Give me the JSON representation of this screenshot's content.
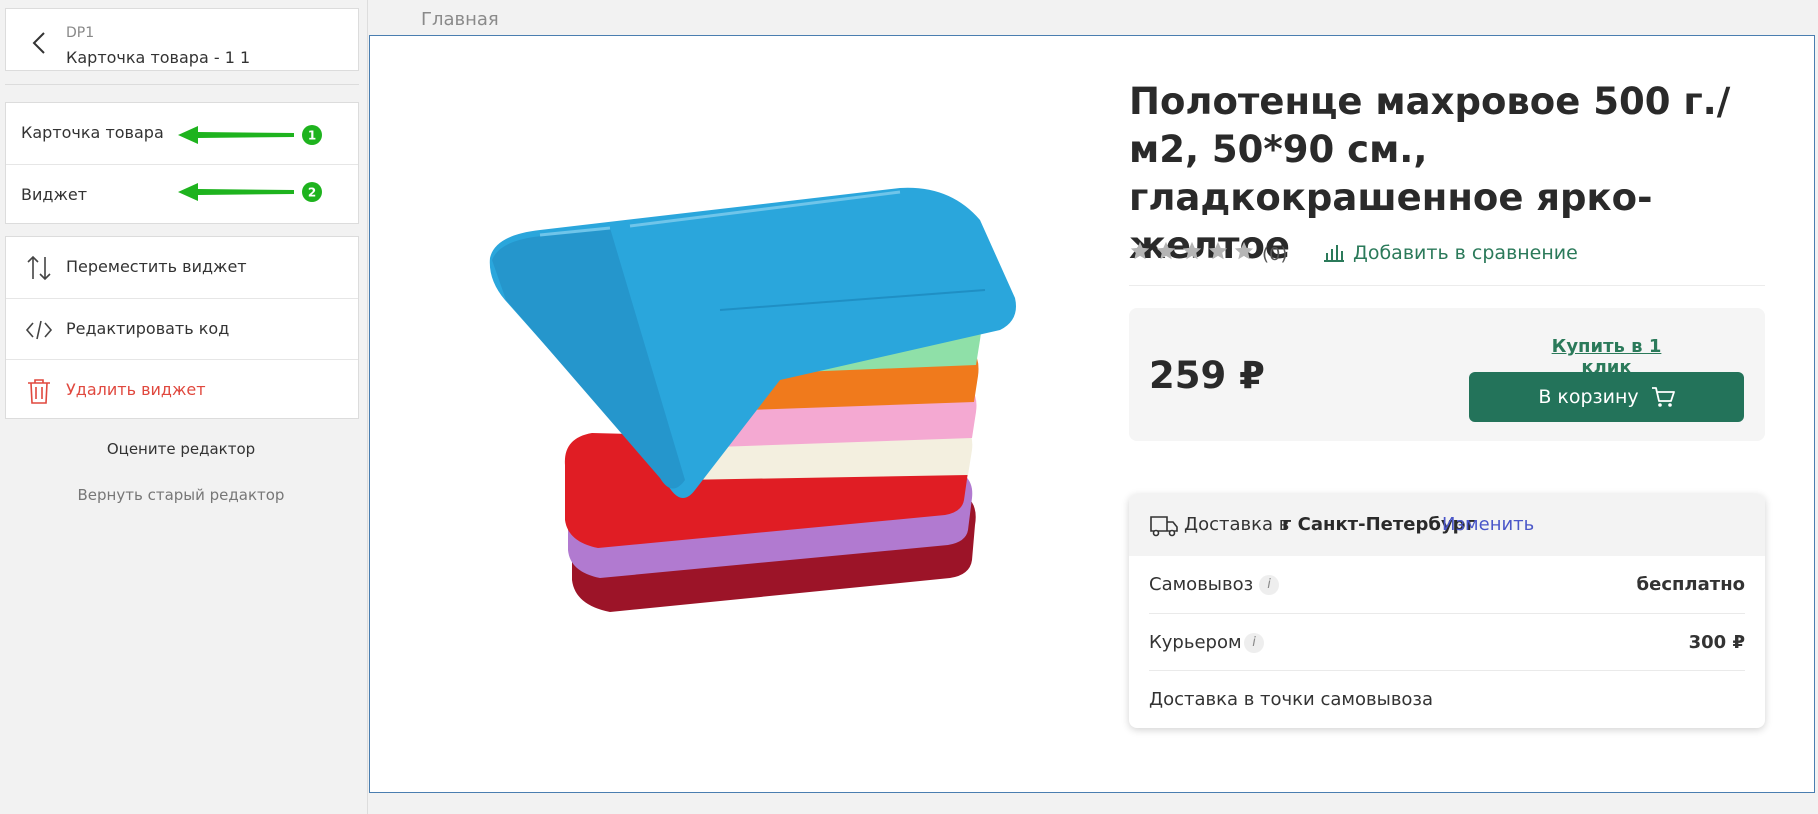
{
  "sidebar": {
    "header": {
      "subtitle": "DP1",
      "title": "Карточка товара - 1 1"
    },
    "nav": [
      {
        "label": "Карточка товара",
        "marker": "1"
      },
      {
        "label": "Виджет",
        "marker": "2"
      }
    ],
    "actions": [
      {
        "label": "Переместить виджет",
        "icon": "sort-arrows-icon"
      },
      {
        "label": "Редактировать код",
        "icon": "code-icon"
      },
      {
        "label": "Удалить виджет",
        "icon": "trash-icon"
      }
    ],
    "rate_label": "Оцените редактор",
    "revert_label": "Вернуть старый редактор"
  },
  "breadcrumb": "Главная",
  "product": {
    "title": "Полотенце махровое 500 г./м2, 50*90 см., гладкокрашенное ярко-желтое",
    "rating_count": "(0)",
    "compare_label": "Добавить в сравнение",
    "price": "259 ₽",
    "one_click_label": "Купить в 1 клик",
    "cart_label": "В корзину"
  },
  "delivery": {
    "prefix": "Доставка в",
    "city": "г Санкт-Петербург",
    "change_label": "Изменить",
    "rows": [
      {
        "name": "Самовывоз",
        "value": "бесплатно"
      },
      {
        "name": "Курьером",
        "value": "300 ₽"
      },
      {
        "name": "Доставка в точки самовывоза",
        "value": ""
      }
    ]
  },
  "colors": {
    "accent": "#23735a",
    "link_green": "#2b7a5a",
    "annotation_green": "#1eb31e",
    "danger": "#e0483e",
    "link_blue": "#4a56c8",
    "canvas_border": "#4a7eb0"
  }
}
